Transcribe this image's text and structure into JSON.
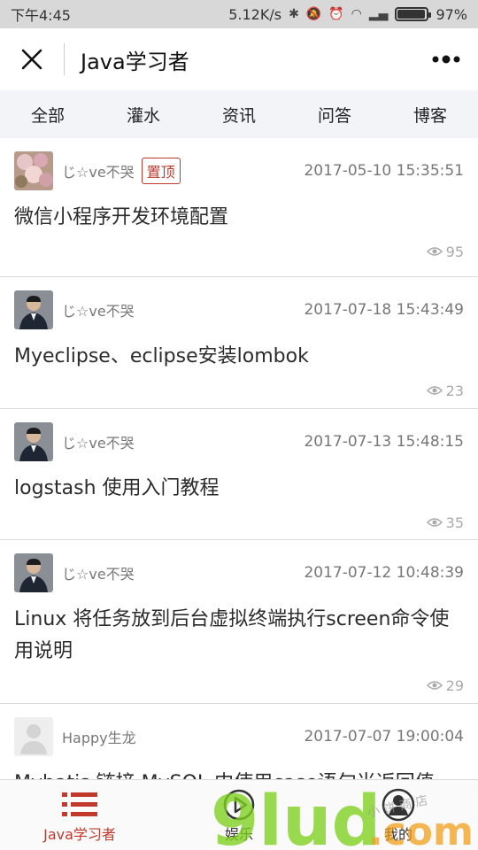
{
  "status_bar": {
    "time": "下午4:45",
    "network_speed": "5.12K/s",
    "battery_percent": "97%",
    "battery_level": 0.97
  },
  "navbar": {
    "title": "Java学习者"
  },
  "tabs": [
    {
      "label": "全部"
    },
    {
      "label": "灌水"
    },
    {
      "label": "资讯"
    },
    {
      "label": "问答"
    },
    {
      "label": "博客"
    }
  ],
  "posts": [
    {
      "author": "じ☆ve不哭",
      "badge": "置顶",
      "date": "2017-05-10 15:35:51",
      "title": "微信小程序开发环境配置",
      "views": "95"
    },
    {
      "author": "じ☆ve不哭",
      "date": "2017-07-18 15:43:49",
      "title": "Myeclipse、eclipse安装lombok",
      "views": "23"
    },
    {
      "author": "じ☆ve不哭",
      "date": "2017-07-13 15:48:15",
      "title": "logstash 使用入门教程",
      "views": "35"
    },
    {
      "author": "じ☆ve不哭",
      "date": "2017-07-12 10:48:39",
      "title": "Linux 将任务放到后台虚拟终端执行screen命令使用说明",
      "views": "29"
    },
    {
      "author": "Happy生龙",
      "date": "2017-07-07 19:00:04",
      "title": "Mybatis 链接 MySQL 中使用case语句当返回值",
      "views": ""
    }
  ],
  "tabbar": [
    {
      "label": "Java学习者",
      "icon": "list-icon",
      "active": true
    },
    {
      "label": "娱乐",
      "icon": "play-icon",
      "active": false
    },
    {
      "label": "我的",
      "icon": "user-icon",
      "active": false
    }
  ],
  "colors": {
    "accent": "#c0392b",
    "tab_bg": "#f2f4f8"
  }
}
